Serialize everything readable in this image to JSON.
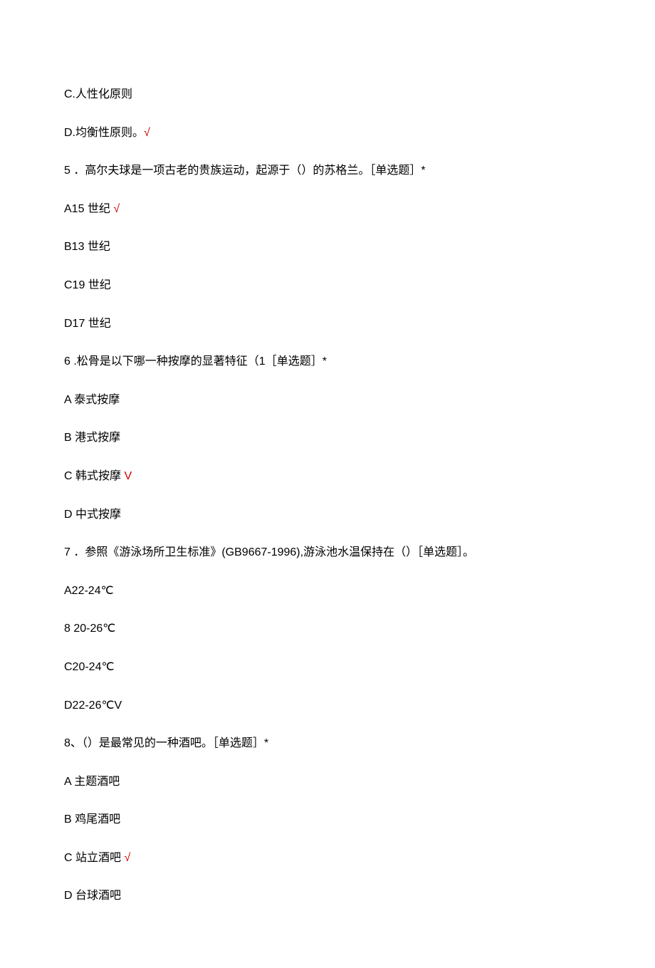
{
  "lines": [
    {
      "text": "C.人性化原则",
      "mark": ""
    },
    {
      "text": "D.均衡性原则。",
      "mark": "√"
    },
    {
      "text": "5 ．高尔夫球是一项古老的贵族运动，起源于（）的苏格兰。［单选题］*",
      "mark": ""
    },
    {
      "text": "A15 世纪 ",
      "mark": "√"
    },
    {
      "text": "B13 世纪",
      "mark": ""
    },
    {
      "text": "C19 世纪",
      "mark": ""
    },
    {
      "text": "D17 世纪",
      "mark": ""
    },
    {
      "text": "6  .松骨是以下哪一种按摩的显著特征（1［单选题］*",
      "mark": ""
    },
    {
      "text": "A 泰式按摩",
      "mark": ""
    },
    {
      "text": "B 港式按摩",
      "mark": ""
    },
    {
      "text": "C 韩式按摩 ",
      "mark": "V"
    },
    {
      "text": "D 中式按摩",
      "mark": ""
    },
    {
      "text": "7 ．参照《游泳场所卫生标准》(GB9667-1996),游泳池水温保持在（）［单选题］。",
      "mark": ""
    },
    {
      "text": "A22-24℃",
      "mark": ""
    },
    {
      "text": "8   20-26℃",
      "mark": ""
    },
    {
      "text": "C20-24℃",
      "mark": ""
    },
    {
      "text": "D22-26℃V",
      "mark": ""
    },
    {
      "text": "8、（）是最常见的一种酒吧。［单选题］*",
      "mark": ""
    },
    {
      "text": "A 主题酒吧",
      "mark": ""
    },
    {
      "text": "B 鸡尾酒吧",
      "mark": ""
    },
    {
      "text": "C 站立酒吧 ",
      "mark": "√"
    },
    {
      "text": "D 台球酒吧",
      "mark": ""
    }
  ]
}
